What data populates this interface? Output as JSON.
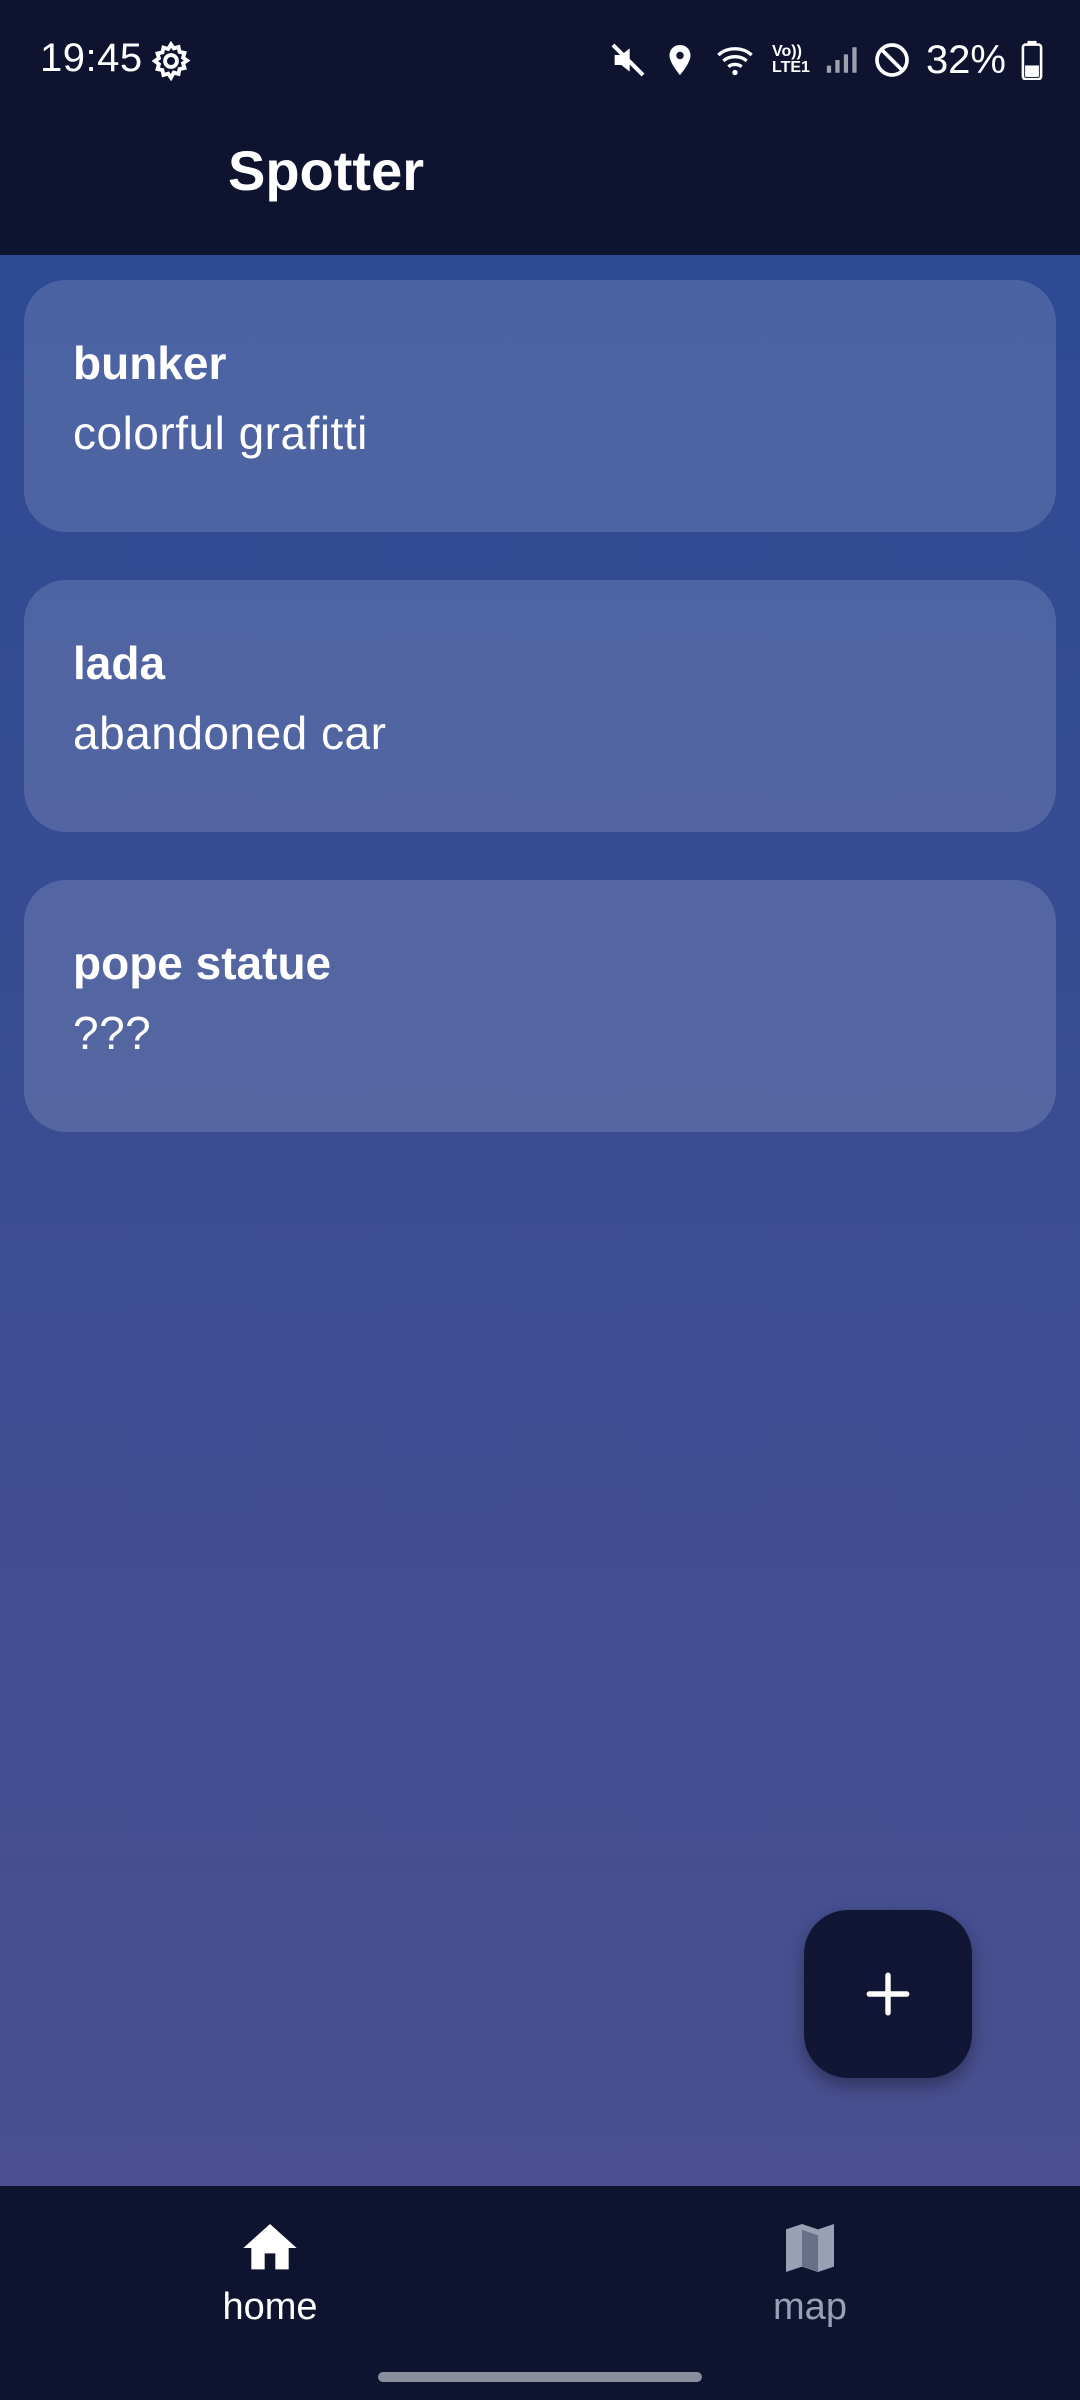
{
  "status_bar": {
    "time": "19:45",
    "settings_icon": "gear-icon",
    "icons": [
      "mute-icon",
      "location-icon",
      "wifi-icon",
      "volte-icon",
      "signal-icon",
      "do-not-disturb-icon",
      "battery-icon"
    ],
    "volte_text": "Vo))",
    "lte_text": "LTE1",
    "battery_percent": "32%"
  },
  "app_bar": {
    "title": "Spotter"
  },
  "spots": [
    {
      "name": "bunker",
      "description": "colorful grafitti"
    },
    {
      "name": "lada",
      "description": "abandoned car"
    },
    {
      "name": "pope statue",
      "description": "???"
    }
  ],
  "fab": {
    "icon": "plus-icon"
  },
  "bottom_nav": {
    "items": [
      {
        "label": "home",
        "icon": "home-icon",
        "active": true
      },
      {
        "label": "map",
        "icon": "map-icon",
        "active": false
      }
    ]
  },
  "colors": {
    "bar_background": "#0e1430",
    "content_gradient_top": "#2e4a94",
    "content_gradient_bottom": "#4a5090",
    "fab_background": "#101634",
    "inactive_nav": "#9aa0b4"
  }
}
